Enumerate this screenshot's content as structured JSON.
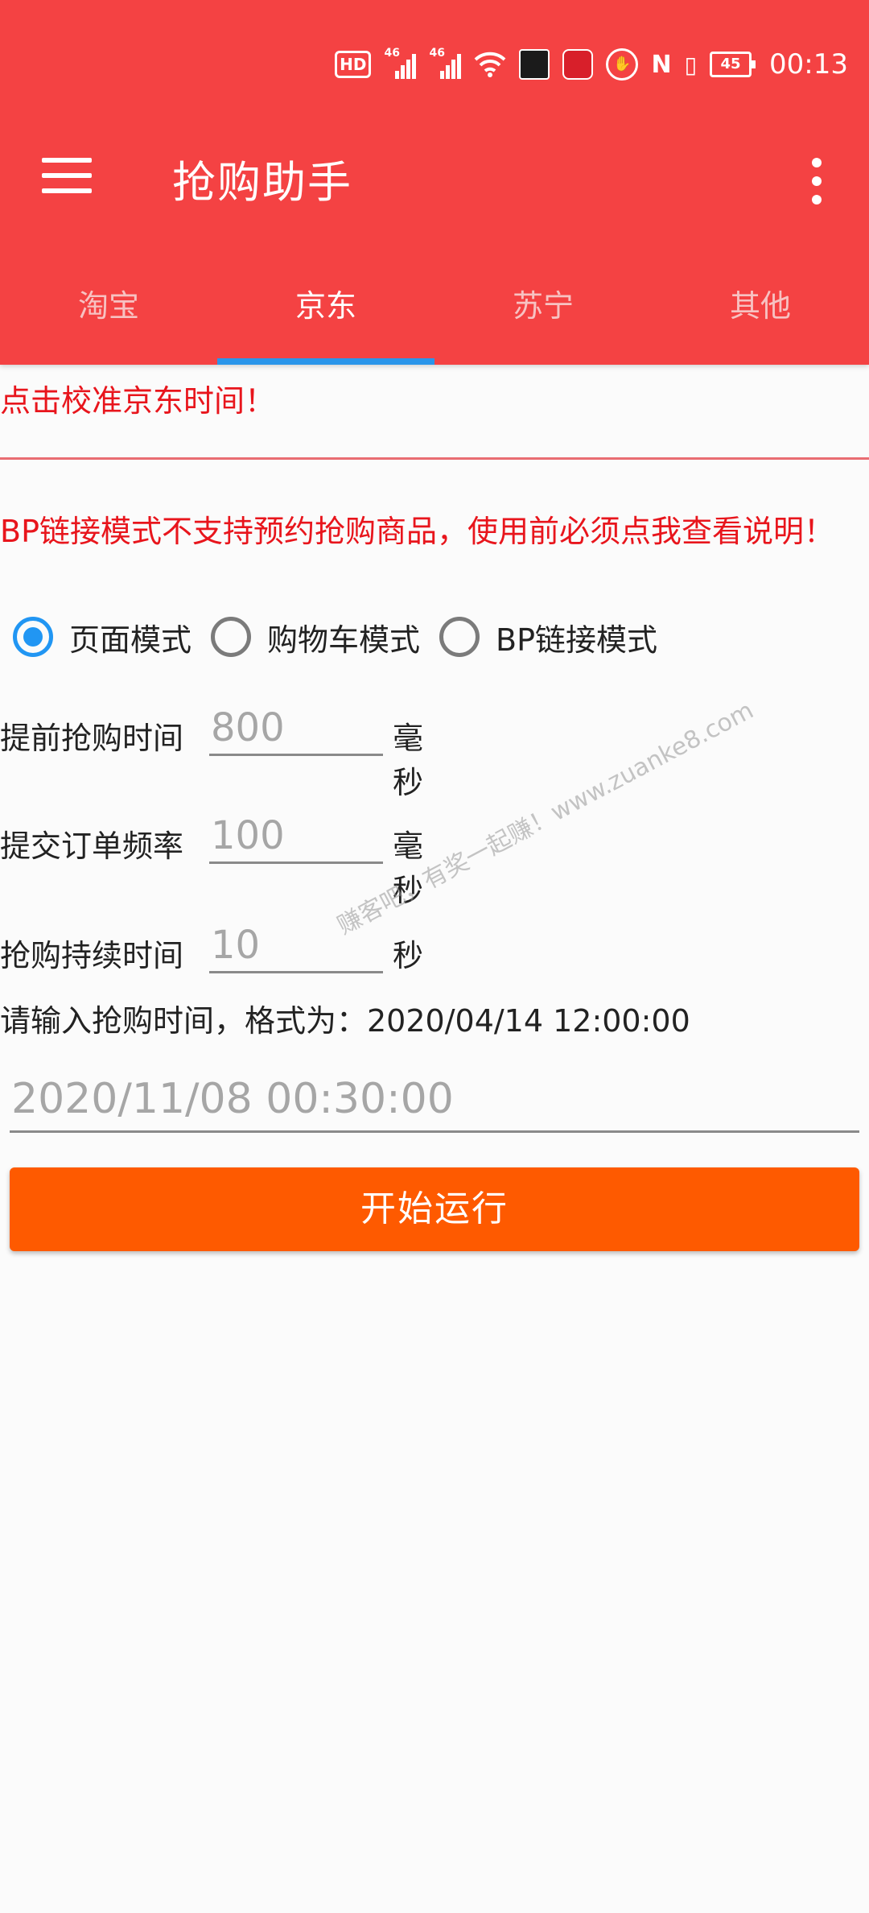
{
  "status_bar": {
    "hd_label": "HD",
    "network_1": "46",
    "network_2": "46",
    "nfc_label": "N",
    "battery_level": "45",
    "time": "00:13",
    "icons": [
      "hd-icon",
      "signal-icon",
      "signal-icon",
      "wifi-icon",
      "app-notification-icon",
      "app-notification-icon",
      "gesture-icon",
      "nfc-icon",
      "vibrate-icon",
      "battery-icon"
    ]
  },
  "toolbar": {
    "title": "抢购助手",
    "menu_icon": "hamburger-menu-icon",
    "more_icon": "more-vert-icon"
  },
  "tabs": [
    {
      "label": "淘宝",
      "active": false
    },
    {
      "label": "京东",
      "active": true
    },
    {
      "label": "苏宁",
      "active": false
    },
    {
      "label": "其他",
      "active": false
    }
  ],
  "main": {
    "calibrate_text": "点击校准京东时间！",
    "warning_text": "BP链接模式不支持预约抢购商品，使用前必须点我查看说明！",
    "modes": [
      {
        "label": "页面模式",
        "selected": true
      },
      {
        "label": "购物车模式",
        "selected": false
      },
      {
        "label": "BP链接模式",
        "selected": false
      }
    ],
    "advance_time": {
      "label": "提前抢购时间",
      "placeholder": "800",
      "unit": "毫秒"
    },
    "submit_rate": {
      "label": "提交订单频率",
      "placeholder": "100",
      "unit": "毫秒"
    },
    "duration": {
      "label": "抢购持续时间",
      "placeholder": "10",
      "unit": "秒"
    },
    "time_hint": "请输入抢购时间，格式为：2020/04/14 12:00:00",
    "time_placeholder": "2020/11/08 00:30:00",
    "start_button": "开始运行"
  },
  "watermark": "赚客吧，有奖一起赚！www.zuanke8.com",
  "colors": {
    "header": "#f44243",
    "tab_indicator": "#2a95ea",
    "warning_text": "#e8151c",
    "radio_selected": "#2196f3",
    "start_button": "#fe5a00"
  }
}
